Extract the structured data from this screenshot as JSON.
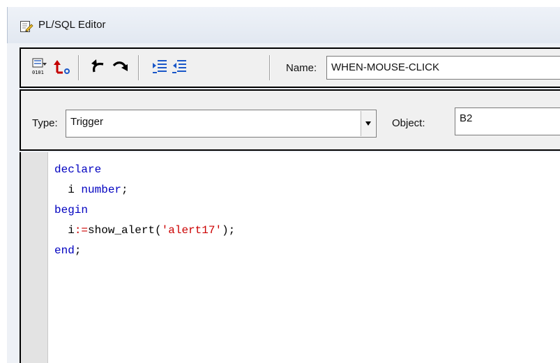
{
  "window": {
    "title": "PL/SQL Editor",
    "title_icon": "edit-document-icon"
  },
  "toolbar": {
    "buttons": [
      {
        "name": "compile-button",
        "icon": "compile-binary-icon"
      },
      {
        "name": "revert-button",
        "icon": "red-arrow-revert-icon"
      },
      {
        "name": "undo-button",
        "icon": "undo-icon"
      },
      {
        "name": "redo-button",
        "icon": "redo-icon"
      },
      {
        "name": "indent-button",
        "icon": "indent-icon"
      },
      {
        "name": "outdent-button",
        "icon": "outdent-icon"
      }
    ],
    "name_label": "Name:",
    "name_value": "WHEN-MOUSE-CLICK"
  },
  "typebar": {
    "type_label": "Type:",
    "type_value": "Trigger",
    "object_label": "Object:",
    "object_value": "B2"
  },
  "editor": {
    "lines": [
      {
        "indent": "",
        "parts": [
          {
            "t": "declare",
            "c": "kw"
          }
        ]
      },
      {
        "indent": "  ",
        "parts": [
          {
            "t": "i ",
            "c": ""
          },
          {
            "t": "number",
            "c": "kw"
          },
          {
            "t": ";",
            "c": ""
          }
        ]
      },
      {
        "indent": "",
        "parts": [
          {
            "t": "begin",
            "c": "kw"
          }
        ]
      },
      {
        "indent": "  ",
        "parts": [
          {
            "t": "i",
            "c": ""
          },
          {
            "t": ":=",
            "c": "op"
          },
          {
            "t": "show_alert(",
            "c": ""
          },
          {
            "t": "'alert17'",
            "c": "str"
          },
          {
            "t": ");",
            "c": ""
          }
        ]
      },
      {
        "indent": "",
        "parts": [
          {
            "t": "end",
            "c": "kw"
          },
          {
            "t": ";",
            "c": ""
          }
        ]
      }
    ]
  },
  "colors": {
    "keyword": "#0000c0",
    "operator": "#cc0000",
    "string": "#cc0000"
  }
}
